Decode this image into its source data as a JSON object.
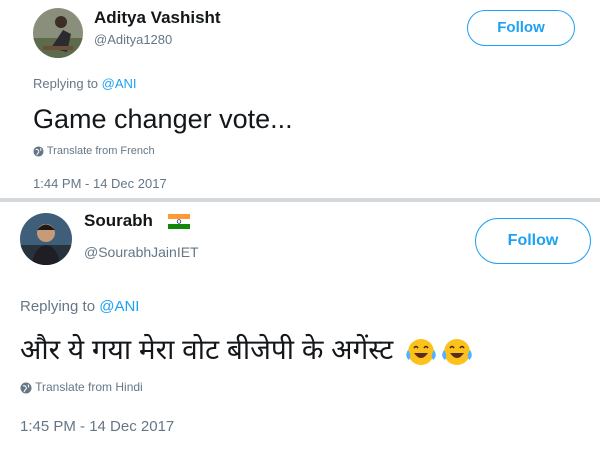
{
  "tweets": [
    {
      "display_name": "Aditya Vashisht",
      "handle": "@Aditya1280",
      "follow_label": "Follow",
      "replying_prefix": "Replying to",
      "replying_handle": "@ANI",
      "text": "Game changer vote...",
      "translate_label": "Translate from French",
      "timestamp": "1:44 PM - 14 Dec 2017"
    },
    {
      "display_name": "Sourabh",
      "handle": "@SourabhJainIET",
      "follow_label": "Follow",
      "replying_prefix": "Replying to",
      "replying_handle": "@ANI",
      "text": "और ये गया मेरा वोट बीजेपी के अगेंस्ट",
      "emoji": [
        "face-with-tears-of-joy",
        "face-with-tears-of-joy"
      ],
      "name_badge": "india-flag",
      "translate_label": "Translate from Hindi",
      "timestamp": "1:45 PM - 14 Dec 2017"
    }
  ],
  "colors": {
    "accent": "#1da1f2",
    "text": "#14171a",
    "muted": "#657786",
    "divider": "#d6d9dc"
  }
}
